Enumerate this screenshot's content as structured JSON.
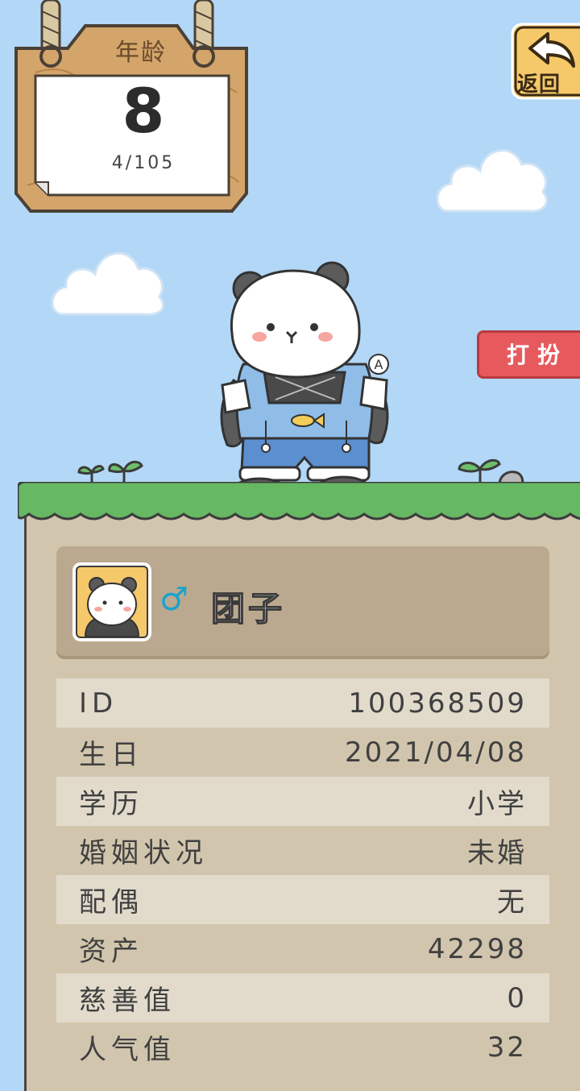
{
  "age_sign": {
    "label": "年龄",
    "value": "8",
    "date": "4/105"
  },
  "back_button": {
    "label": "返回"
  },
  "dress_button": {
    "label": "打扮"
  },
  "profile": {
    "gender_symbol": "♂",
    "name": "团子"
  },
  "info_rows": [
    {
      "label": "ID",
      "value": "100368509"
    },
    {
      "label": "生日",
      "value": "2021/04/08"
    },
    {
      "label": "学历",
      "value": "小学"
    },
    {
      "label": "婚姻状况",
      "value": "未婚"
    },
    {
      "label": "配偶",
      "value": "无"
    },
    {
      "label": "资产",
      "value": "42298"
    },
    {
      "label": "慈善值",
      "value": "0"
    },
    {
      "label": "人气值",
      "value": "32"
    }
  ],
  "colors": {
    "sky": "#b3d7f6",
    "grass": "#67b863",
    "panel": "#d1c5ad",
    "card": "#bba98f",
    "stripe": "#e2dbcc",
    "dress_button": "#e65a5e",
    "back_button": "#f5c86a",
    "gender": "#1aa3cc"
  },
  "icons": [
    "back-arrow-icon",
    "male-icon",
    "panda-avatar-icon",
    "fish-icon",
    "cloud-icon",
    "sprout-icon"
  ]
}
